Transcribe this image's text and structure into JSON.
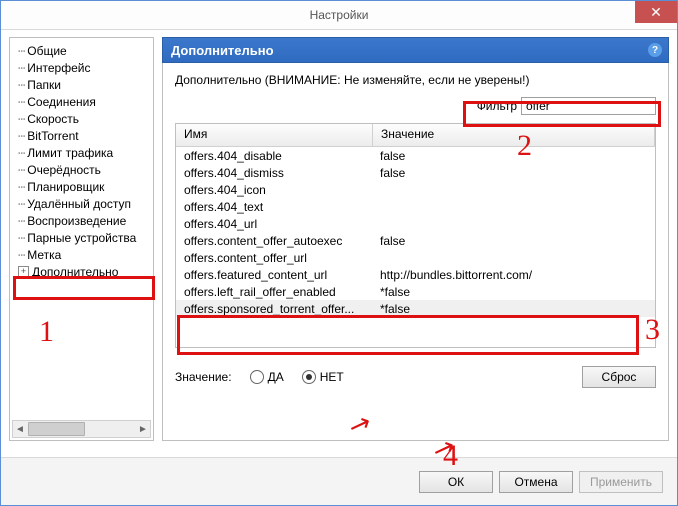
{
  "window": {
    "title": "Настройки",
    "close_glyph": "✕"
  },
  "tree": {
    "items": [
      "Общие",
      "Интерфейс",
      "Папки",
      "Соединения",
      "Скорость",
      "BitTorrent",
      "Лимит трафика",
      "Очерёдность",
      "Планировщик",
      "Удалённый доступ",
      "Воспроизведение",
      "Парные устройства",
      "Метка"
    ],
    "last_item": "Дополнительно",
    "plus": "+"
  },
  "section": {
    "title": "Дополнительно",
    "help": "?",
    "warning": "Дополнительно (ВНИМАНИЕ: Не изменяйте, если не уверены!)",
    "filter_label": "Фильтр",
    "filter_value": "offer"
  },
  "table": {
    "col_name": "Имя",
    "col_value": "Значение",
    "rows": [
      {
        "name": "offers.404_disable",
        "value": "false",
        "selected": false
      },
      {
        "name": "offers.404_dismiss",
        "value": "false",
        "selected": false
      },
      {
        "name": "offers.404_icon",
        "value": "",
        "selected": false
      },
      {
        "name": "offers.404_text",
        "value": "",
        "selected": false
      },
      {
        "name": "offers.404_url",
        "value": "",
        "selected": false
      },
      {
        "name": "offers.content_offer_autoexec",
        "value": "false",
        "selected": false
      },
      {
        "name": "offers.content_offer_url",
        "value": "",
        "selected": false
      },
      {
        "name": "offers.featured_content_url",
        "value": "http://bundles.bittorrent.com/",
        "selected": false
      },
      {
        "name": "offers.left_rail_offer_enabled",
        "value": "*false",
        "selected": false
      },
      {
        "name": "offers.sponsored_torrent_offer...",
        "value": "*false",
        "selected": true
      }
    ]
  },
  "value_editor": {
    "label": "Значение:",
    "yes": "ДА",
    "no": "НЕТ",
    "reset": "Сброс"
  },
  "buttons": {
    "ok": "ОК",
    "cancel": "Отмена",
    "apply": "Применить"
  },
  "annotations": {
    "n1": "1",
    "n2": "2",
    "n3": "3",
    "n4": "4"
  }
}
